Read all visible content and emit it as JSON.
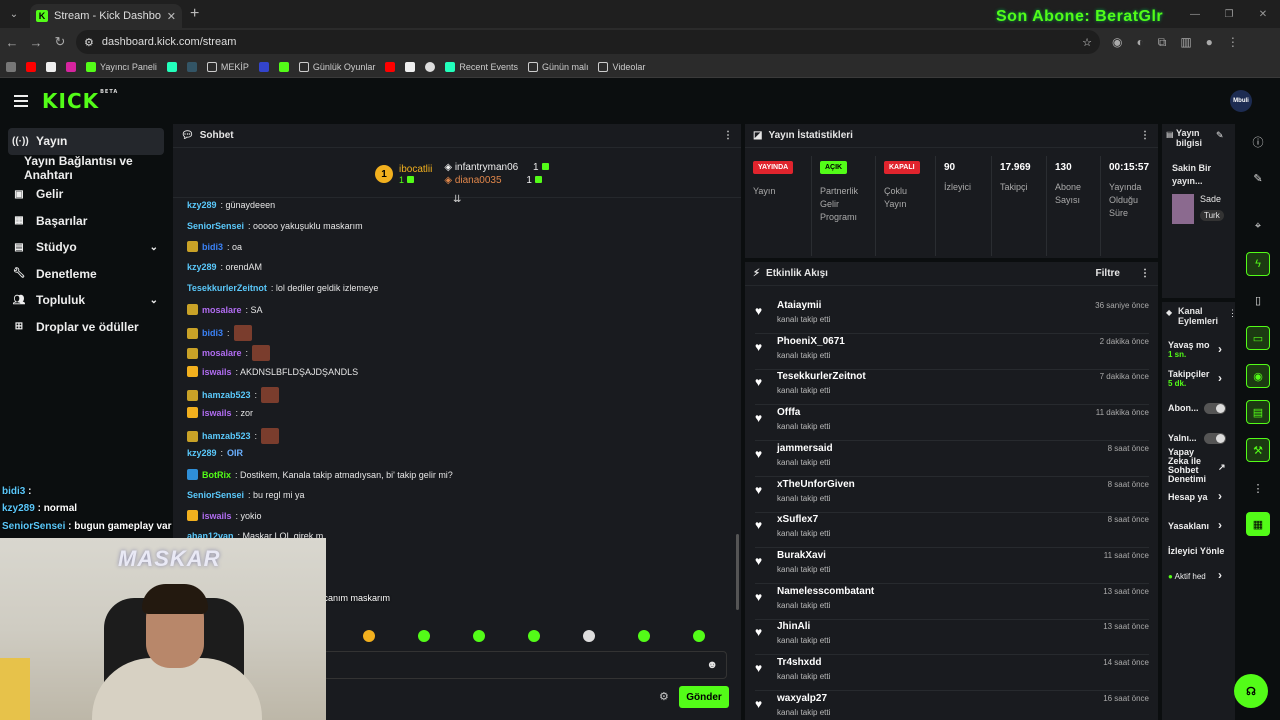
{
  "browser": {
    "tab_title": "Stream - Kick Dashboard",
    "url": "dashboard.kick.com/stream",
    "overlay_text": "Son Abone: BeratGlr",
    "bookmarks": [
      "Yayıncı Paneli",
      "MEKİP",
      "Günlük Oyunlar",
      "Recent Events",
      "Günün malı",
      "Videolar"
    ]
  },
  "header": {
    "logo": "KICK",
    "beta": "BETA",
    "avatar_text": "Mbuli"
  },
  "sidebar": {
    "items": [
      {
        "label": "Yayın"
      },
      {
        "label": "Yayın Bağlantısı ve Anahtarı"
      },
      {
        "label": "Gelir"
      },
      {
        "label": "Başarılar"
      },
      {
        "label": "Stüdyo"
      },
      {
        "label": "Denetleme"
      },
      {
        "label": "Topluluk"
      },
      {
        "label": "Droplar ve ödüller"
      }
    ]
  },
  "overlay_chat": [
    {
      "user": "bidi3",
      "text": " : "
    },
    {
      "user": "kzy289",
      "text": " : normal"
    },
    {
      "user": "SeniorSensei",
      "text": " : bugun gameplay var canım maskarım"
    }
  ],
  "webcam": {
    "logo": "MASKAR"
  },
  "chat": {
    "title": "Sohbet",
    "gift_top": {
      "rank": "1",
      "user": "ibocatlii",
      "count": "1"
    },
    "gift_right": [
      {
        "user": "infantryman06",
        "count": "1"
      },
      {
        "user": "diana0035",
        "count": "1"
      }
    ],
    "messages": [
      {
        "user": "kzy289",
        "text": ": günaydeeen",
        "color": "#5ac8fa"
      },
      {
        "user": "SeniorSensei",
        "text": ": ooooo yakuşuklu maskarım",
        "color": "#5ac8fa"
      },
      {
        "user": "bidi3",
        "text": ": oa",
        "color": "#3b82f6"
      },
      {
        "user": "kzy289",
        "text": ": orendAM",
        "color": "#5ac8fa"
      },
      {
        "user": "TesekkurlerZeitnot",
        "text": ": lol dediler geldik izlemeye",
        "color": "#5ac8fa"
      },
      {
        "user": "mosalare",
        "text": ": SA",
        "color": "#b06cf0"
      },
      {
        "user": "bidi3",
        "text": ":",
        "color": "#3b82f6"
      },
      {
        "user": "mosalare",
        "text": ":",
        "color": "#b06cf0"
      },
      {
        "user": "iswails",
        "text": ": AKDNSLBFLDŞAJDŞANDLS",
        "color": "#b06cf0"
      },
      {
        "user": "hamzab523",
        "text": ":",
        "color": "#5ac8fa"
      },
      {
        "user": "iswails",
        "text": ": zor",
        "color": "#b06cf0"
      },
      {
        "user": "hamzab523",
        "text": ":",
        "color": "#5ac8fa"
      },
      {
        "user": "kzy289",
        "text": ":",
        "color": "#5ac8fa"
      },
      {
        "user": "BotRix",
        "text": ": Dostikem, Kanala takip atmadıysan, bi' takip gelir mi?",
        "color": "#53fc18"
      },
      {
        "user": "SeniorSensei",
        "text": ": bu regl mi ya",
        "color": "#5ac8fa"
      },
      {
        "user": "iswails",
        "text": ": yokio",
        "color": "#b06cf0"
      },
      {
        "user": "ahan12van",
        "text": ": Maskar LOL girek m",
        "color": "#5ac8fa"
      }
    ],
    "partial_text": "ar canım maskarım",
    "send_label": "Gönder",
    "kzy_emote": "OIR"
  },
  "stats": {
    "title": "Yayın İstatistikleri",
    "cells": [
      {
        "badge": "YAYINDA",
        "label": "Yayın",
        "badge_color": "#e0242d"
      },
      {
        "badge": "AÇIK",
        "label": "Partnerlik Gelir Programı",
        "badge_color": "#53fc18"
      },
      {
        "badge": "KAPALI",
        "label": "Çoklu Yayın",
        "badge_color": "#e0242d"
      },
      {
        "value": "90",
        "label": "İzleyici"
      },
      {
        "value": "17.969",
        "label": "Takipçi"
      },
      {
        "value": "130",
        "label": "Abone Sayısı"
      },
      {
        "value": "00:15:57",
        "label": "Yayında Olduğu Süre"
      }
    ]
  },
  "activity": {
    "title": "Etkinlik Akışı",
    "filter": "Filtre",
    "sub": "kanalı takip etti",
    "items": [
      {
        "name": "Ataiaymii",
        "time": "36 saniye önce"
      },
      {
        "name": "PhoeniX_0671",
        "time": "2 dakika önce"
      },
      {
        "name": "TesekkurlerZeitnot",
        "time": "7 dakika önce"
      },
      {
        "name": "Offfa",
        "time": "11 dakika önce"
      },
      {
        "name": "jammersaid",
        "time": "8 saat önce"
      },
      {
        "name": "xTheUnforGiven",
        "time": "8 saat önce"
      },
      {
        "name": "xSuflex7",
        "time": "8 saat önce"
      },
      {
        "name": "BurakXavi",
        "time": "11 saat önce"
      },
      {
        "name": "Namelesscombatant",
        "time": "13 saat önce"
      },
      {
        "name": "JhinAli",
        "time": "13 saat önce"
      },
      {
        "name": "Tr4shxdd",
        "time": "14 saat önce"
      },
      {
        "name": "waxyalp27",
        "time": "16 saat önce"
      }
    ]
  },
  "stream_info": {
    "title": "Yayın bilgisi",
    "stream_title": "Sakin Bir yayın...",
    "category": "Sade",
    "tag": "Turk"
  },
  "channel_actions": {
    "title": "Kanal Eylemleri",
    "slow_mode": "Yavaş mo",
    "slow_val": "1 sn.",
    "followers": "Takipçiler",
    "followers_val": "5 dk.",
    "subs": "Abon...",
    "yaln": "Yalnı...",
    "ai": "Yapay Zeka ile Sohbet Denetimi",
    "hesap": "Hesap ya",
    "banned": "Yasaklanı",
    "viewer": "İzleyici Yönle",
    "active": "Aktif hed"
  }
}
